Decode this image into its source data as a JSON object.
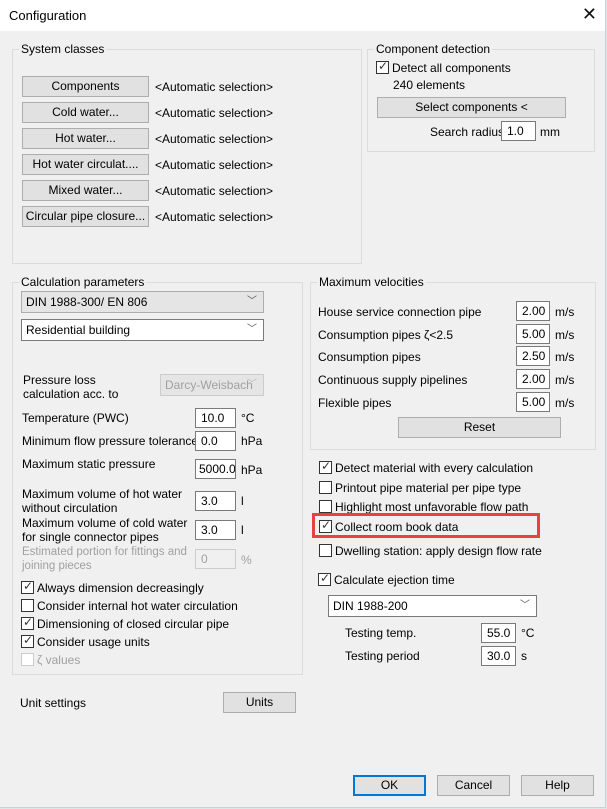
{
  "window": {
    "title": "Configuration",
    "close_icon": "close-icon"
  },
  "system_classes": {
    "title": "System classes",
    "rows": [
      {
        "button": "Components",
        "value": "<Automatic selection>"
      },
      {
        "button": "Cold water...",
        "value": "<Automatic selection>"
      },
      {
        "button": "Hot water...",
        "value": "<Automatic selection>"
      },
      {
        "button": "Hot water circulat....",
        "value": "<Automatic selection>"
      },
      {
        "button": "Mixed water...",
        "value": "<Automatic selection>"
      },
      {
        "button": "Circular pipe closure...",
        "value": "<Automatic selection>"
      }
    ]
  },
  "component_detection": {
    "title": "Component detection",
    "detect_all": {
      "label": "Detect all components",
      "checked": true
    },
    "element_count": "240 elements",
    "select_button": "Select components <",
    "search_radius": {
      "label": "Search radius",
      "value": "1.0",
      "unit": "mm"
    }
  },
  "calculation_parameters": {
    "title": "Calculation parameters",
    "standard": "DIN 1988-300/ EN 806",
    "building_type": "Residential building",
    "pressure_loss": {
      "label": "Pressure loss calculation acc. to",
      "value": "Darcy-Weisbach"
    },
    "fields": [
      {
        "label": "Temperature (PWC)",
        "value": "10.0",
        "unit": "°C"
      },
      {
        "label": "Minimum flow pressure tolerance",
        "value": "0.0",
        "unit": "hPa"
      },
      {
        "label": "Maximum static pressure",
        "value": "5000.0",
        "unit": "hPa"
      },
      {
        "label": "Maximum volume of hot water without circulation",
        "value": "3.0",
        "unit": "l"
      },
      {
        "label": "Maximum volume of cold water for single connector pipes",
        "value": "3.0",
        "unit": "l"
      },
      {
        "label": "Estimated portion for fittings and joining pieces",
        "value": "0",
        "unit": "%",
        "disabled": true
      }
    ],
    "checkboxes": [
      {
        "label": "Always dimension decreasingly",
        "checked": true
      },
      {
        "label": "Consider internal hot water circulation",
        "checked": false
      },
      {
        "label": "Dimensioning of closed circular pipe",
        "checked": true
      },
      {
        "label": "Consider usage units",
        "checked": true
      },
      {
        "label": "ζ values",
        "checked": false,
        "disabled": true
      }
    ]
  },
  "max_velocities": {
    "title": "Maximum velocities",
    "rows": [
      {
        "label": "House service connection pipe",
        "value": "2.00",
        "unit": "m/s"
      },
      {
        "label": "Consumption pipes ζ<2.5",
        "value": "5.00",
        "unit": "m/s"
      },
      {
        "label": "Consumption pipes",
        "value": "2.50",
        "unit": "m/s"
      },
      {
        "label": "Continuous supply pipelines",
        "value": "2.00",
        "unit": "m/s"
      },
      {
        "label": "Flexible pipes",
        "value": "5.00",
        "unit": "m/s"
      }
    ],
    "reset_button": "Reset"
  },
  "options": [
    {
      "label": "Detect material with every calculation",
      "checked": true
    },
    {
      "label": "Printout pipe material per pipe type",
      "checked": false
    },
    {
      "label": "Highlight most unfavorable flow path",
      "checked": false
    },
    {
      "label": "Collect room book data",
      "checked": true,
      "highlighted": true
    },
    {
      "label": "Dwelling station: apply design flow rate",
      "checked": false
    }
  ],
  "ejection": {
    "checkbox": {
      "label": "Calculate ejection time",
      "checked": true
    },
    "standard": "DIN 1988-200",
    "testing_temp": {
      "label": "Testing temp.",
      "value": "55.0",
      "unit": "°C"
    },
    "testing_period": {
      "label": "Testing period",
      "value": "30.0",
      "unit": "s"
    }
  },
  "unit_settings": {
    "label": "Unit settings",
    "button": "Units"
  },
  "footer": {
    "ok": "OK",
    "cancel": "Cancel",
    "help": "Help"
  },
  "colors": {
    "highlight": "#e8413f",
    "default_button_border": "#0078d7",
    "dialog_bg": "#f0f0f0"
  }
}
